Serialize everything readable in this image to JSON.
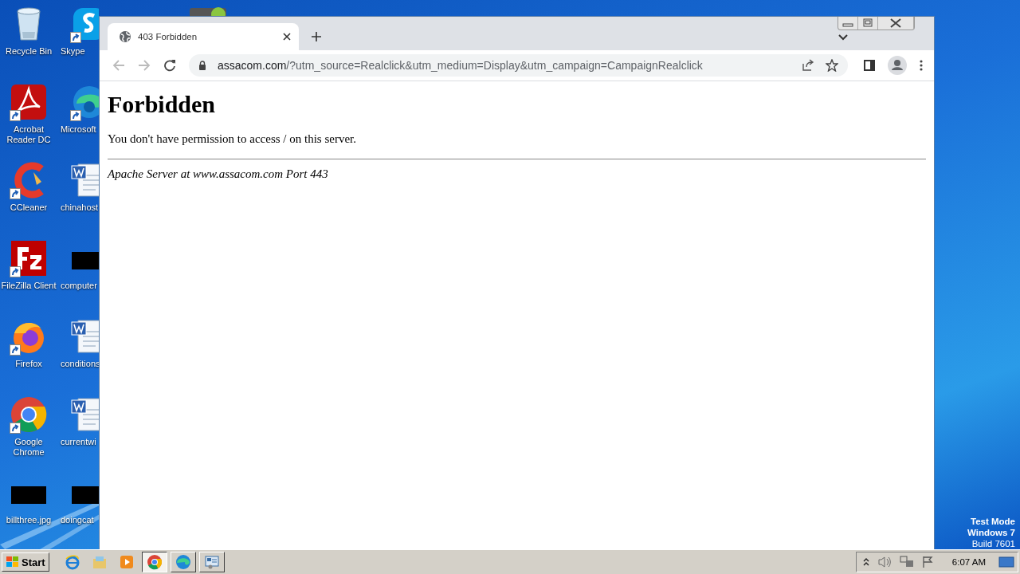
{
  "desktop": {
    "icons": [
      {
        "label": "Recycle Bin",
        "kind": "recycle",
        "shortcut": false
      },
      {
        "label": "Skype",
        "kind": "skype",
        "shortcut": true
      },
      {
        "label": "Acrobat Reader DC",
        "kind": "acrobat",
        "shortcut": true
      },
      {
        "label": "Microsoft",
        "kind": "edge",
        "shortcut": true
      },
      {
        "label": "CCleaner",
        "kind": "ccleaner",
        "shortcut": true
      },
      {
        "label": "chinahost",
        "kind": "word",
        "shortcut": false
      },
      {
        "label": "FileZilla Client",
        "kind": "filezilla",
        "shortcut": true
      },
      {
        "label": "computer",
        "kind": "blackout",
        "shortcut": false
      },
      {
        "label": "Firefox",
        "kind": "firefox",
        "shortcut": true
      },
      {
        "label": "conditions",
        "kind": "word",
        "shortcut": false
      },
      {
        "label": "Google Chrome",
        "kind": "chrome",
        "shortcut": true
      },
      {
        "label": "currentwi",
        "kind": "word",
        "shortcut": false
      },
      {
        "label": "billthree.jpg",
        "kind": "blackout",
        "shortcut": false
      },
      {
        "label": "doingcat",
        "kind": "blackout",
        "shortcut": false
      }
    ],
    "covered_icon": {
      "kind": "app"
    },
    "os_notice": [
      "Test Mode",
      "Windows 7",
      "Build 7601"
    ]
  },
  "browser": {
    "tabs": [
      {
        "title": "403 Forbidden",
        "selected": true
      }
    ],
    "address": {
      "host": "assacom.com",
      "rest": "/?utm_source=Realclick&utm_medium=Display&utm_campaign=CampaignRealclick"
    },
    "page": {
      "heading": "Forbidden",
      "message": "You don't have permission to access / on this server.",
      "signature": "Apache Server at www.assacom.com Port 443"
    }
  },
  "taskbar": {
    "start": "Start",
    "apps": [
      {
        "kind": "ie",
        "selected": false
      },
      {
        "kind": "explorer",
        "selected": false
      },
      {
        "kind": "media",
        "selected": false
      },
      {
        "kind": "chrome",
        "selected": true
      },
      {
        "kind": "edge",
        "selected": false
      },
      {
        "kind": "remote",
        "selected": false
      }
    ],
    "clock": "6:07 AM"
  }
}
